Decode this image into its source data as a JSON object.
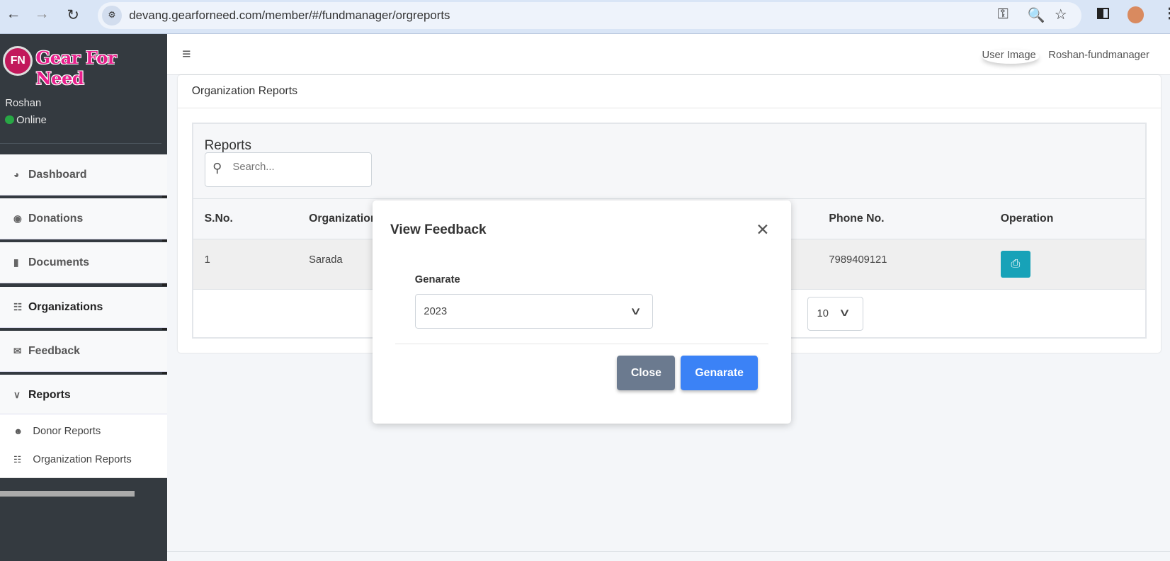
{
  "browser": {
    "url": "devang.gearforneed.com/member/#/fundmanager/orgreports",
    "icons": [
      "back-icon",
      "forward-icon",
      "reload-icon",
      "site-settings-icon",
      "key-icon",
      "zoom-out-icon",
      "star-icon",
      "side-panel-icon",
      "profile-avatar",
      "more-menu-icon"
    ]
  },
  "sidebar": {
    "logo_text": "Gear For Need",
    "logo_mark": "FN",
    "user": "Roshan",
    "status": "Online",
    "status_color": "#28a745",
    "items": [
      {
        "label": "Dashboard",
        "icon": "chart-pie-icon"
      },
      {
        "label": "Donations",
        "icon": "money-icon"
      },
      {
        "label": "Documents",
        "icon": "file-icon"
      },
      {
        "label": "Organizations",
        "icon": "sitemap-icon"
      },
      {
        "label": "Feedback",
        "icon": "envelope-icon"
      },
      {
        "label": "Reports",
        "icon": "chevron-down-icon"
      }
    ],
    "subitems": [
      {
        "label": "Donor Reports",
        "icon": "users-icon"
      },
      {
        "label": "Organization Reports",
        "icon": "sitemap-icon"
      }
    ]
  },
  "navbar": {
    "user_image_alt": "User Image",
    "username": "Roshan-fundmanager"
  },
  "card": {
    "title": "Organization Reports",
    "section_title": "Reports",
    "search_placeholder": "Search...",
    "columns": [
      "S.No.",
      "Organization",
      "Phone No.",
      "Operation"
    ],
    "rows": [
      {
        "sno": "1",
        "organization": "Sarada",
        "phone": "7989409121"
      }
    ],
    "page_size": "10",
    "print_color": "#17a2b8"
  },
  "modal": {
    "title": "View Feedback",
    "label": "Genarate",
    "selected_year": "2023",
    "close_label": "Close",
    "generate_label": "Genarate",
    "generate_color": "#3b82f6"
  }
}
